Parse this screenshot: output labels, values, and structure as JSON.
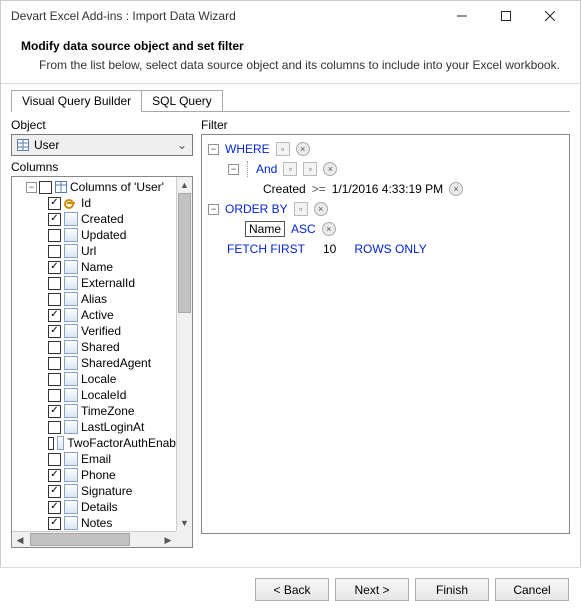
{
  "window": {
    "title": "Devart Excel Add-ins : Import Data Wizard"
  },
  "header": {
    "title": "Modify data source object and set filter",
    "subtitle": "From the list below, select data source object and its columns to include into your Excel workbook."
  },
  "tabs": {
    "visual": "Visual Query Builder",
    "sql": "SQL Query"
  },
  "left": {
    "object_label": "Object",
    "object_value": "User",
    "columns_label": "Columns",
    "root": "Columns of 'User'",
    "cols": [
      {
        "name": "Id",
        "checked": true,
        "key": true
      },
      {
        "name": "Created",
        "checked": true,
        "key": false
      },
      {
        "name": "Updated",
        "checked": false,
        "key": false
      },
      {
        "name": "Url",
        "checked": false,
        "key": false
      },
      {
        "name": "Name",
        "checked": true,
        "key": false
      },
      {
        "name": "ExternalId",
        "checked": false,
        "key": false
      },
      {
        "name": "Alias",
        "checked": false,
        "key": false
      },
      {
        "name": "Active",
        "checked": true,
        "key": false
      },
      {
        "name": "Verified",
        "checked": true,
        "key": false
      },
      {
        "name": "Shared",
        "checked": false,
        "key": false
      },
      {
        "name": "SharedAgent",
        "checked": false,
        "key": false
      },
      {
        "name": "Locale",
        "checked": false,
        "key": false
      },
      {
        "name": "LocaleId",
        "checked": false,
        "key": false
      },
      {
        "name": "TimeZone",
        "checked": true,
        "key": false
      },
      {
        "name": "LastLoginAt",
        "checked": false,
        "key": false
      },
      {
        "name": "TwoFactorAuthEnabled",
        "checked": false,
        "key": false
      },
      {
        "name": "Email",
        "checked": false,
        "key": false
      },
      {
        "name": "Phone",
        "checked": true,
        "key": false
      },
      {
        "name": "Signature",
        "checked": true,
        "key": false
      },
      {
        "name": "Details",
        "checked": true,
        "key": false
      },
      {
        "name": "Notes",
        "checked": true,
        "key": false
      }
    ]
  },
  "filter": {
    "label": "Filter",
    "where": "WHERE",
    "and": "And",
    "cond_field": "Created",
    "cond_op": ">=",
    "cond_val": "1/1/2016 4:33:19 PM",
    "orderby": "ORDER BY",
    "sort_field": "Name",
    "sort_dir": "ASC",
    "fetch": "FETCH FIRST",
    "fetch_n": "10",
    "fetch_rows": "ROWS ONLY"
  },
  "footer": {
    "back": "< Back",
    "next": "Next >",
    "finish": "Finish",
    "cancel": "Cancel"
  }
}
